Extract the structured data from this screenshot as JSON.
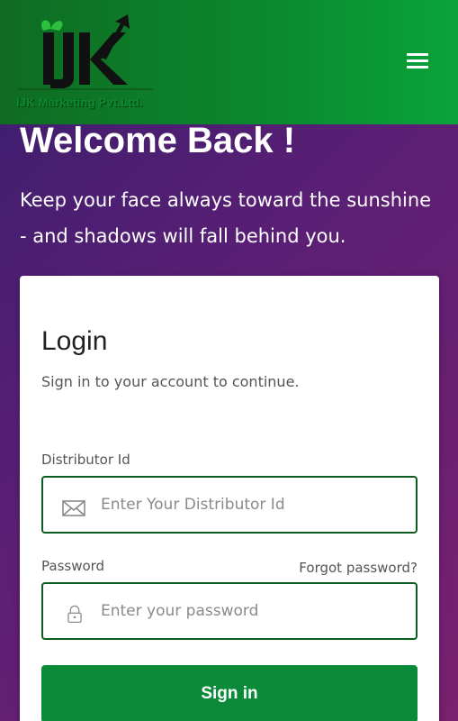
{
  "header": {
    "logo_text": "IJK",
    "logo_tagline": "IJK Marketing Pvt.Ltd.",
    "menu_icon": "hamburger-icon",
    "bg_color": "#0b8a2e"
  },
  "hero": {
    "title": "Welcome Back !",
    "quote": "Keep your face always toward the sunshine - and shadows will fall behind you."
  },
  "login": {
    "title": "Login",
    "subtitle": "Sign in to your account to continue.",
    "distributor": {
      "label": "Distributor Id",
      "placeholder": "Enter Your Distributor Id",
      "icon": "envelope-icon"
    },
    "password": {
      "label": "Password",
      "placeholder": "Enter your password",
      "icon": "lock-icon",
      "forgot": "Forgot password?"
    },
    "submit": "Sign in",
    "accent_color": "#0b8a3a"
  }
}
